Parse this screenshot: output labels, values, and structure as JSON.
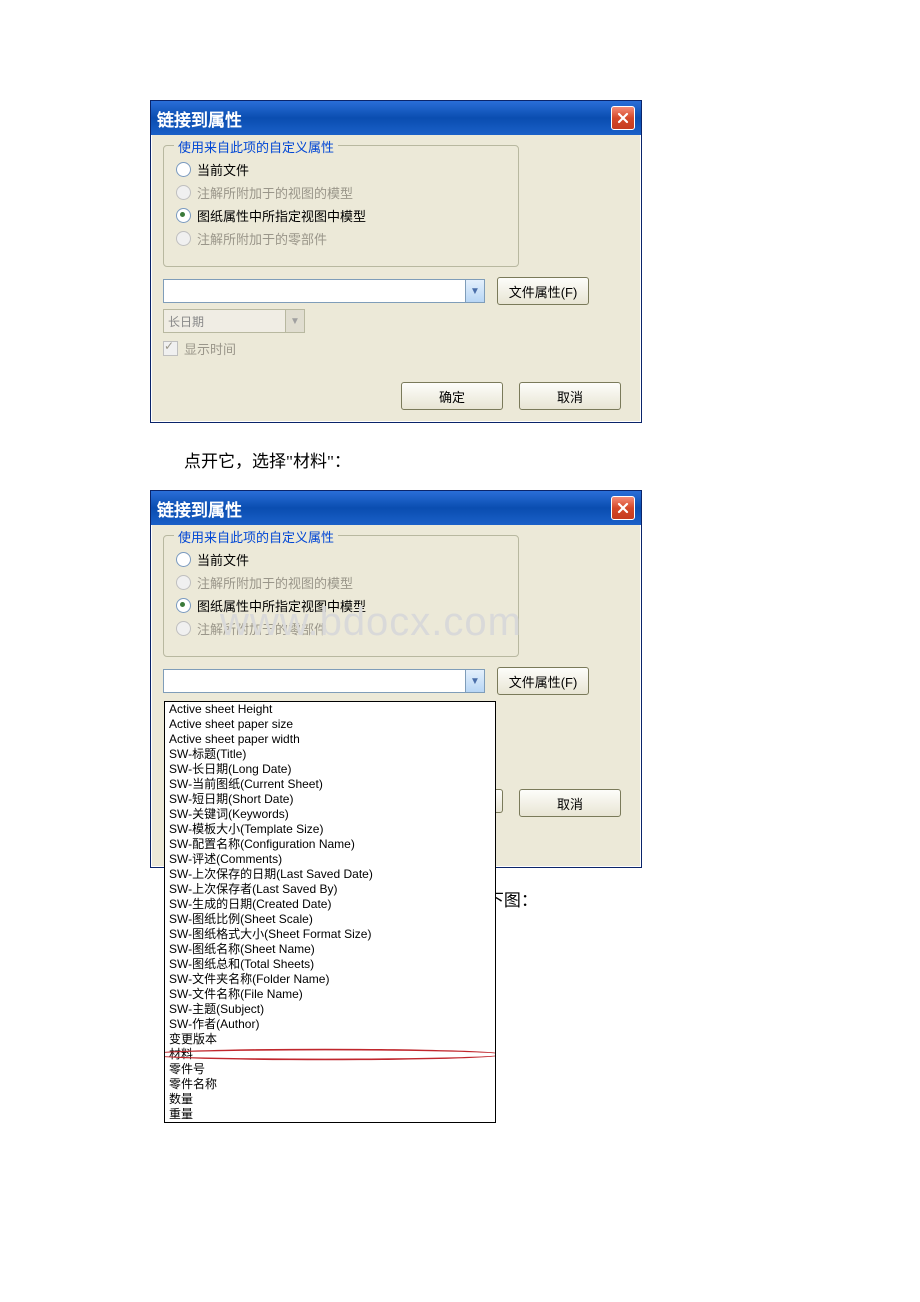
{
  "dialog1": {
    "title": "链接到属性",
    "group_title": "使用来自此项的自定义属性",
    "radio_current": "当前文件",
    "radio_annotated_view": "注解所附加于的视图的模型",
    "radio_sheet_model": "图纸属性中所指定视图中模型",
    "radio_annotated_part": "注解所附加于的零部件",
    "file_props_btn": "文件属性(F)",
    "date_combo": "长日期",
    "show_time": "显示时间",
    "ok": "确定",
    "cancel": "取消"
  },
  "caption1": "点开它，选择\"材料\"：",
  "dialog2": {
    "title": "链接到属性",
    "group_title": "使用来自此项的自定义属性",
    "radio_current": "当前文件",
    "radio_annotated_view": "注解所附加于的视图的模型",
    "radio_sheet_model": "图纸属性中所指定视图中模型",
    "radio_annotated_part": "注解所附加于的零部件",
    "file_props_btn": "文件属性(F)",
    "cancel": "取消",
    "dropdown_items": [
      "Active sheet Height",
      "Active sheet paper size",
      "Active sheet paper width",
      "SW-标题(Title)",
      "SW-长日期(Long Date)",
      "SW-当前图纸(Current Sheet)",
      "SW-短日期(Short Date)",
      "SW-关键词(Keywords)",
      "SW-模板大小(Template Size)",
      "SW-配置名称(Configuration Name)",
      "SW-评述(Comments)",
      "SW-上次保存的日期(Last Saved Date)",
      "SW-上次保存者(Last Saved By)",
      "SW-生成的日期(Created Date)",
      "SW-图纸比例(Sheet Scale)",
      "SW-图纸格式大小(Sheet Format Size)",
      "SW-图纸名称(Sheet Name)",
      "SW-图纸总和(Total Sheets)",
      "SW-文件夹名称(Folder Name)",
      "SW-文件名称(File Name)",
      "SW-主题(Subject)",
      "SW-作者(Author)",
      "变更版本",
      "材料",
      "零件号",
      "零件名称",
      "数量",
      "重量"
    ],
    "circled_index": 23
  },
  "caption2": "这样就插入了一个\"属性变量\"的文本，如下图：",
  "watermark": "www.bdocx.com"
}
